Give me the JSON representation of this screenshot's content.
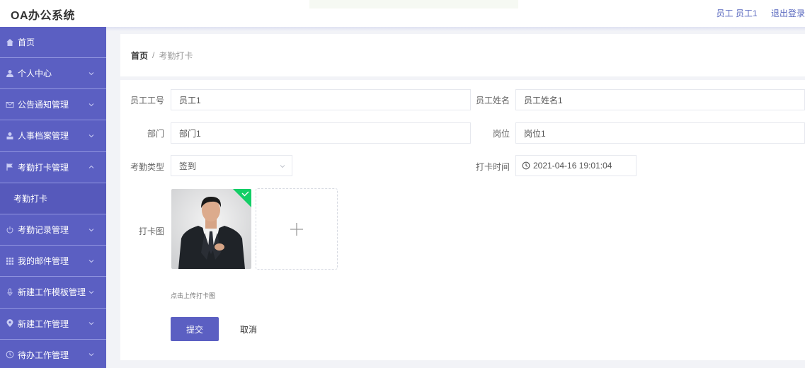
{
  "header": {
    "brand": "OA办公系统",
    "user_role": "员工",
    "user_name": "员工1",
    "logout": "退出登录"
  },
  "sidebar": {
    "items": [
      {
        "label": "首页",
        "icon": "home-icon"
      },
      {
        "label": "个人中心",
        "icon": "user-icon"
      },
      {
        "label": "公告通知管理",
        "icon": "mail-icon"
      },
      {
        "label": "人事档案管理",
        "icon": "person-icon"
      },
      {
        "label": "考勤打卡管理",
        "icon": "flag-icon"
      },
      {
        "label": "考勤打卡",
        "icon": ""
      },
      {
        "label": "考勤记录管理",
        "icon": "power-icon"
      },
      {
        "label": "我的邮件管理",
        "icon": "grid-icon"
      },
      {
        "label": "新建工作模板管理",
        "icon": "mic-icon"
      },
      {
        "label": "新建工作管理",
        "icon": "location-icon"
      },
      {
        "label": "待办工作管理",
        "icon": "clock-icon"
      }
    ]
  },
  "breadcrumb": {
    "home": "首页",
    "separator": "/",
    "current": "考勤打卡"
  },
  "form": {
    "emp_no_label": "员工工号",
    "emp_no_value": "员工1",
    "emp_name_label": "员工姓名",
    "emp_name_value": "员工姓名1",
    "dept_label": "部门",
    "dept_value": "部门1",
    "post_label": "岗位",
    "post_value": "岗位1",
    "type_label": "考勤类型",
    "type_value": "签到",
    "time_label": "打卡时间",
    "time_value": "2021-04-16 19:01:04",
    "photo_label": "打卡图",
    "upload_tip": "点击上传打卡图",
    "submit": "提交",
    "cancel": "取消"
  },
  "colors": {
    "primary": "#5b5fc2",
    "success": "#13ce66"
  }
}
